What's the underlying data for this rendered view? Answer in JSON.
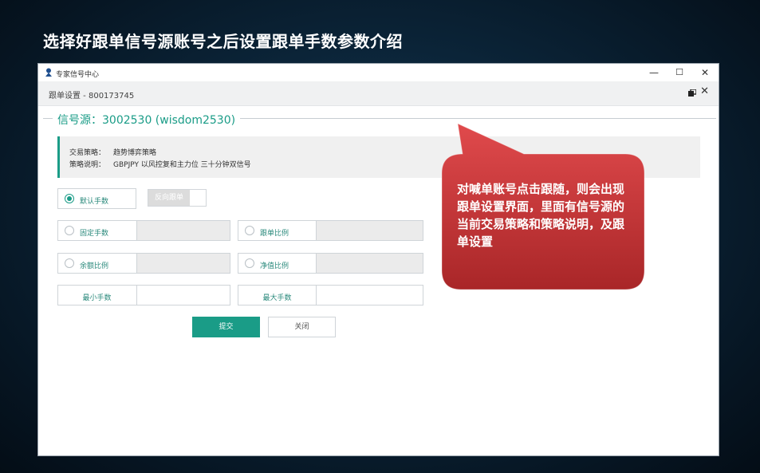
{
  "slide": {
    "title": "选择好跟单信号源账号之后设置跟单手数参数介绍"
  },
  "window": {
    "app_title": "专家信号中心",
    "controls": {
      "minimize": "—",
      "maximize": "☐",
      "close": "✕"
    },
    "subheader_label": "跟单设置 - 800173745"
  },
  "signal_source": {
    "label": "信号源：3002530 (wisdom2530)"
  },
  "strategy": {
    "trade_key": "交易策略：",
    "trade_value": "趋势博弈策略",
    "desc_key": "策略说明：",
    "desc_value": "GBPJPY 以风控复和主力位 三十分钟双信号"
  },
  "options": {
    "default_lots": "默认手数",
    "reverse": "反向跟单",
    "fixed_lots": "固定手数",
    "follow_ratio": "跟单比例",
    "balance_ratio": "余额比例",
    "equity_ratio": "净值比例",
    "min_lots": "最小手数",
    "max_lots": "最大手数"
  },
  "buttons": {
    "submit": "提交",
    "close": "关闭"
  },
  "callout": {
    "text": "对喊单账号点击跟随，则会出现跟单设置界面，里面有信号源的当前交易策略和策略说明，及跟单设置",
    "fill": "#c8383a"
  },
  "colors": {
    "accent": "#1a9c87"
  }
}
